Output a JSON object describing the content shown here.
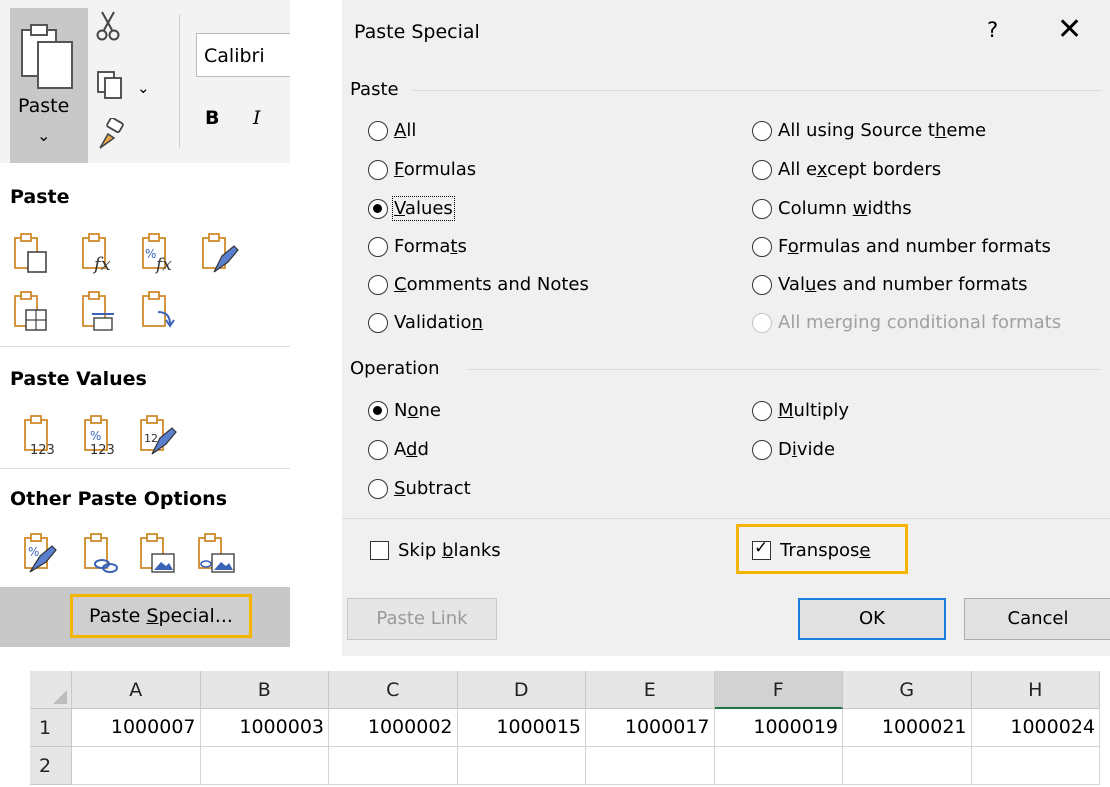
{
  "ribbon": {
    "paste_label": "Paste",
    "font_name": "Calibri",
    "bold_label": "B",
    "italic_label": "I"
  },
  "paste_menu": {
    "section_paste": "Paste",
    "section_values": "Paste Values",
    "section_other": "Other Paste Options",
    "paste_special_button": "Paste Special..."
  },
  "dialog": {
    "title": "Paste Special",
    "help": "?",
    "close": "✕",
    "paste_group_label": "Paste",
    "paste_options": [
      {
        "label": "All",
        "checked": false
      },
      {
        "label": "Formulas",
        "checked": false
      },
      {
        "label": "Values",
        "checked": true
      },
      {
        "label": "Formats",
        "checked": false
      },
      {
        "label": "Comments and Notes",
        "checked": false
      },
      {
        "label": "Validation",
        "checked": false
      },
      {
        "label": "All using Source theme",
        "checked": false
      },
      {
        "label": "All except borders",
        "checked": false
      },
      {
        "label": "Column widths",
        "checked": false
      },
      {
        "label": "Formulas and number formats",
        "checked": false
      },
      {
        "label": "Values and number formats",
        "checked": false
      },
      {
        "label": "All merging conditional formats",
        "checked": false,
        "disabled": true
      }
    ],
    "operation_group_label": "Operation",
    "operation_options": [
      {
        "label": "None",
        "checked": true
      },
      {
        "label": "Add",
        "checked": false
      },
      {
        "label": "Subtract",
        "checked": false
      },
      {
        "label": "Multiply",
        "checked": false
      },
      {
        "label": "Divide",
        "checked": false
      }
    ],
    "skip_blanks": {
      "label": "Skip blanks",
      "checked": false
    },
    "transpose": {
      "label": "Transpose",
      "checked": true
    },
    "buttons": {
      "paste_link": "Paste Link",
      "ok": "OK",
      "cancel": "Cancel"
    }
  },
  "sheet": {
    "columns": [
      "A",
      "B",
      "C",
      "D",
      "E",
      "F",
      "G",
      "H"
    ],
    "selected_column": "F",
    "rows": [
      {
        "header": "1",
        "cells": [
          "1000007",
          "1000003",
          "1000002",
          "1000015",
          "1000017",
          "1000019",
          "1000021",
          "1000024"
        ]
      },
      {
        "header": "2",
        "cells": [
          "",
          "",
          "",
          "",
          "",
          "",
          "",
          ""
        ]
      }
    ],
    "accent_color": "#217346",
    "highlight_color": "#f4b400"
  }
}
